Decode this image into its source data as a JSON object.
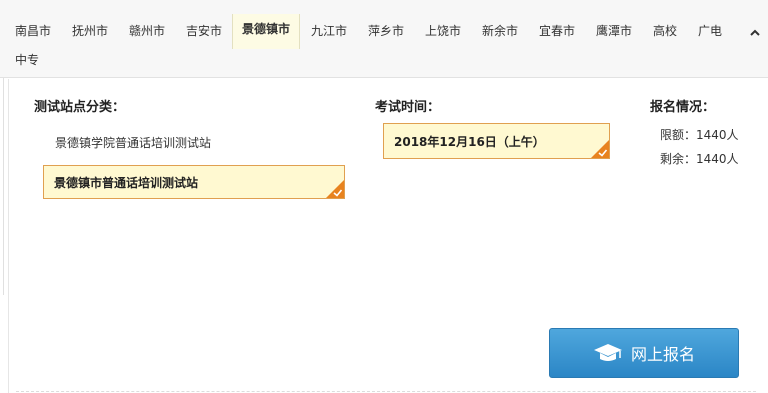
{
  "tabs": [
    {
      "label": "南昌市"
    },
    {
      "label": "抚州市"
    },
    {
      "label": "赣州市"
    },
    {
      "label": "吉安市"
    },
    {
      "label": "景德镇市",
      "active": true
    },
    {
      "label": "九江市"
    },
    {
      "label": "萍乡市"
    },
    {
      "label": "上饶市"
    },
    {
      "label": "新余市"
    },
    {
      "label": "宜春市"
    },
    {
      "label": "鹰潭市"
    },
    {
      "label": "高校"
    },
    {
      "label": "广电"
    },
    {
      "label": "中专"
    }
  ],
  "collapse_icon": "chevron-up-icon",
  "sites": {
    "heading": "测试站点分类：",
    "items": [
      {
        "label": "景德镇学院普通话培训测试站",
        "selected": false
      },
      {
        "label": "景德镇市普通话培训测试站",
        "selected": true
      }
    ]
  },
  "exam_time": {
    "heading": "考试时间：",
    "items": [
      {
        "label": "2018年12月16日（上午）",
        "selected": true
      }
    ]
  },
  "registration": {
    "heading": "报名情况：",
    "limit": "限额：1440人",
    "remaining": "剩余：1440人"
  },
  "register_button": {
    "label": "网上报名",
    "icon": "graduation-cap-icon"
  },
  "colors": {
    "accent_orange": "#e8831f",
    "selected_bg": "#fff9d1",
    "button_blue": "#2b86c6"
  }
}
